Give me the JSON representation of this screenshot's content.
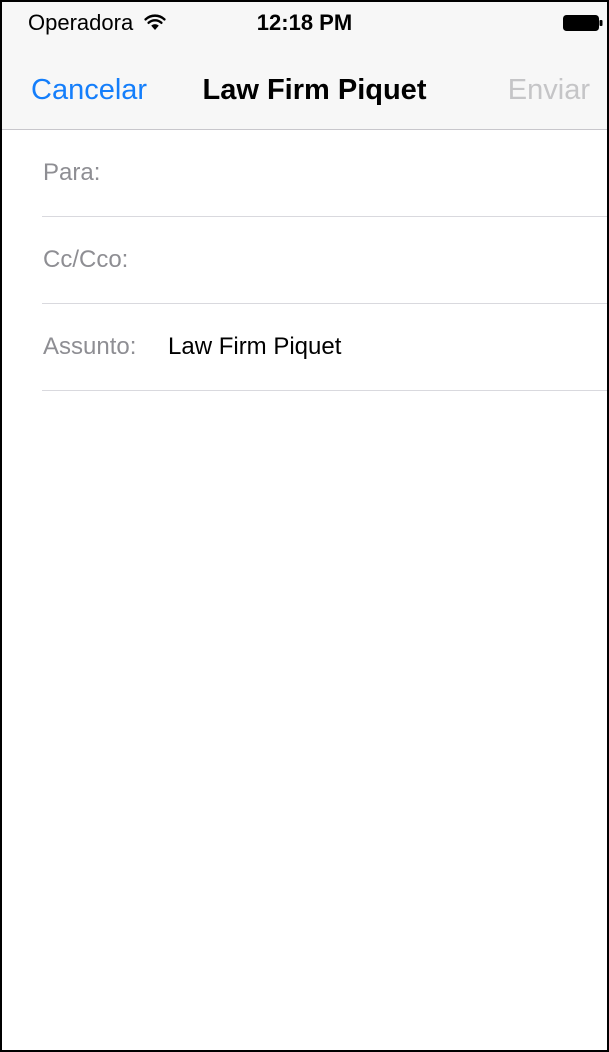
{
  "status_bar": {
    "carrier": "Operadora",
    "wifi_icon": "wifi-icon",
    "time": "12:18 PM",
    "battery_icon": "battery-icon"
  },
  "nav": {
    "cancel_label": "Cancelar",
    "title": "Law Firm Piquet",
    "send_label": "Enviar"
  },
  "fields": {
    "to_label": "Para:",
    "to_value": "",
    "cc_label": "Cc/Cco:",
    "cc_value": "",
    "subject_label": "Assunto:",
    "subject_value": "Law Firm Piquet"
  },
  "body": {
    "text": ""
  },
  "colors": {
    "accent": "#147efb",
    "disabled": "#c5c5c7",
    "label": "#8e8e93",
    "bar_background": "#f7f7f7",
    "separator": "#d9d9de"
  }
}
